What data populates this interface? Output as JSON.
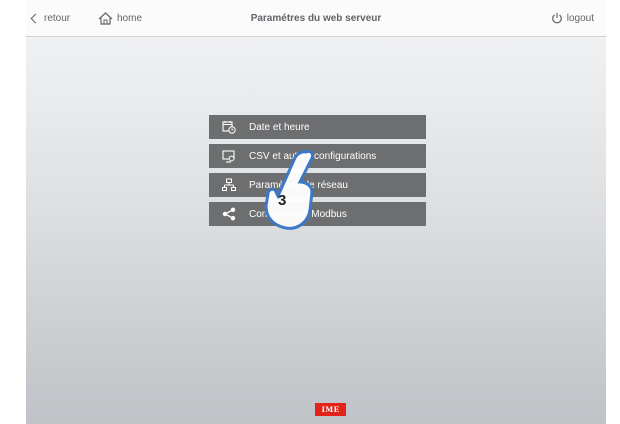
{
  "topbar": {
    "back_label": "retour",
    "home_label": "home",
    "title": "Paramétres du web serveur",
    "logout_label": "logout"
  },
  "menu": {
    "items": [
      {
        "label": "Date et heure",
        "icon": "calendar-clock-icon"
      },
      {
        "label": "CSV et autres configurations",
        "icon": "monitor-gear-icon"
      },
      {
        "label": "Paramètres de réseau",
        "icon": "network-icon"
      },
      {
        "label": "Configuration Modbus",
        "icon": "share-icon"
      }
    ]
  },
  "overlay": {
    "step_number": "3"
  },
  "footer": {
    "logo_text": "IME"
  },
  "colors": {
    "menu_bg": "#6d6e70",
    "logo_red": "#e2231a"
  }
}
